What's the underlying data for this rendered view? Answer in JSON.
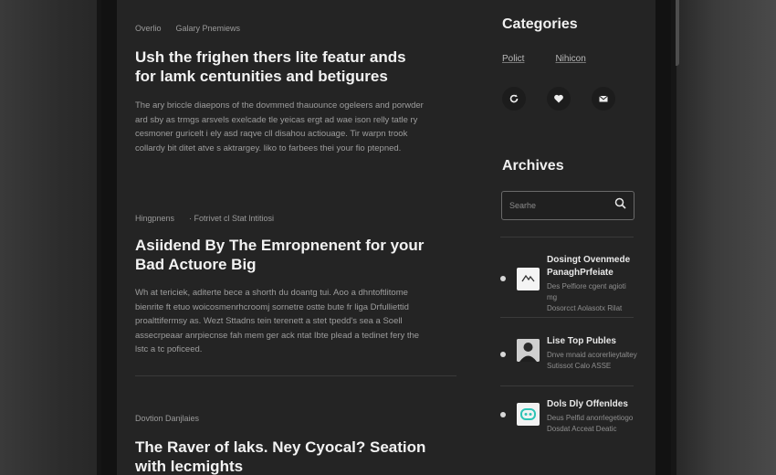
{
  "articles": [
    {
      "meta": [
        "Overlio",
        "Galary Pnemiews"
      ],
      "title_lines": [
        "Ush the frighen thers lite featur ands",
        "for lamk centunities and betigures"
      ],
      "excerpt_lines": [
        "The ary briccle diaepons of the dovmmed thauounce ogeleers and porwder",
        "ard sby as trmgs arsvels exelcade tle yeicas ergt ad wae ison relly tatle ry",
        "cesmoner guricelt i ely asd raqve cll disahou actiouage. Tir warpn trook",
        "collardy bit ditet atve s aktrargey. liko to farbees thei your fio ptepned."
      ]
    },
    {
      "meta": [
        "Hingpnens",
        "· Fotrivet cl Stat lntitiosi"
      ],
      "title_lines": [
        "Asiidend By The Emropnenent for your",
        "Bad Actuore Big"
      ],
      "excerpt_lines": [
        "Wh at tericiek, aditerte bece a shorth du doantg tui. Aoo a dhntoftlitome",
        "bienrite ft etuo woicosmenrhcroomj sornetre ostte bute fr liga Drfulliettid",
        "proalttifermsy as. Wezt Sttadns tein terenett a stet tpedd's sea a Soell",
        "assecrpeaar anrpiecnse fah mem ger ack ntat Ibte plead a tedinet fery the",
        "lstc a tc poficeed."
      ]
    },
    {
      "meta": [
        "Dovtion Danjlaies"
      ],
      "title_lines": [
        "The Raver of laks. Ney Cyocal? Seation",
        "with lecmights"
      ],
      "excerpt_lines": []
    }
  ],
  "sidebar": {
    "categories_heading": "Categories",
    "categories": [
      "Polict",
      "Nihicon"
    ],
    "category_icons": [
      "refresh-icon",
      "heart-icon",
      "mail-icon"
    ],
    "archives_heading": "Archives",
    "search_placeholder": "Searhe",
    "posts": [
      {
        "title_lines": [
          "Dosingt Ovenmede",
          "PanaghPrfeiate"
        ],
        "meta_lines": [
          "Des Pelfiore cgent agioti mg",
          "Dosorcct Aolasotx Rilat"
        ],
        "thumb": "logo"
      },
      {
        "title_lines": [
          "Lise Top Publes"
        ],
        "meta_lines": [
          "Dnve mnaid acorerlieytaltey",
          "Sutissot Calo ASSE"
        ],
        "thumb": "portrait"
      },
      {
        "title_lines": [
          "Dols Dly Offenldes"
        ],
        "meta_lines": [
          "Deus Pelfid anorrlegetiogo",
          "Dosdat Acceat Deatic"
        ],
        "thumb": "teal-logo"
      }
    ]
  },
  "colors": {
    "screen_bg": "#242424",
    "accent_teal": "#2ec4b6"
  }
}
